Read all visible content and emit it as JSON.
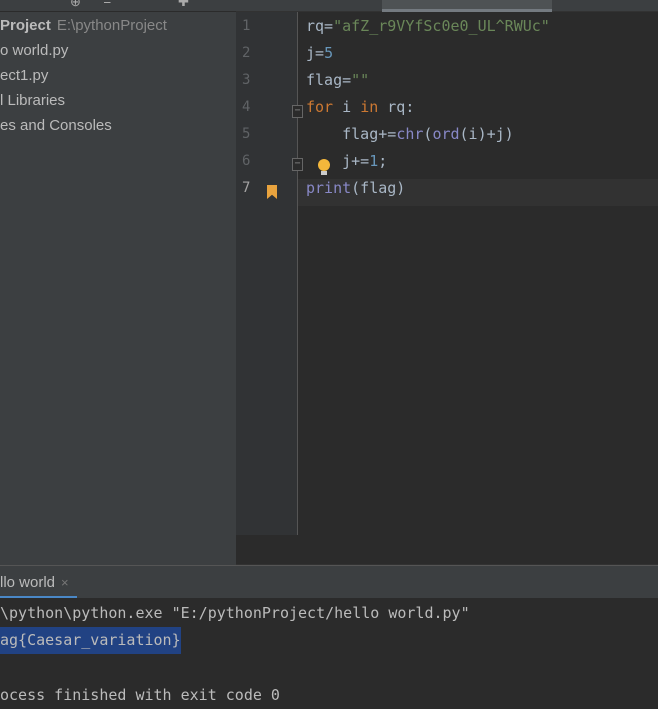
{
  "project_panel": {
    "title": "Project",
    "path": "E:\\pythonProject",
    "items": [
      "o world.py",
      "ect1.py",
      "l Libraries",
      "es and Consoles"
    ]
  },
  "editor": {
    "line_numbers": [
      "1",
      "2",
      "3",
      "4",
      "5",
      "6",
      "7"
    ],
    "lines": [
      {
        "parts": [
          [
            "",
            "rq="
          ],
          [
            "str",
            "\"afZ_r9VYfSc0e0_UL^RWUc\""
          ]
        ]
      },
      {
        "parts": [
          [
            "",
            "j="
          ],
          [
            "num",
            "5"
          ]
        ]
      },
      {
        "parts": [
          [
            "",
            "flag="
          ],
          [
            "str",
            "\"\""
          ]
        ]
      },
      {
        "parts": [
          [
            "kw",
            "for"
          ],
          [
            "",
            " i "
          ],
          [
            "kw",
            "in"
          ],
          [
            "",
            " rq:"
          ]
        ]
      },
      {
        "parts": [
          [
            "",
            "    flag+="
          ],
          [
            "fn",
            "chr"
          ],
          [
            "",
            "("
          ],
          [
            "fn",
            "ord"
          ],
          [
            "",
            "(i)+j)"
          ]
        ]
      },
      {
        "parts": [
          [
            "",
            "    j+="
          ],
          [
            "num",
            "1"
          ],
          [
            "",
            ";"
          ]
        ]
      },
      {
        "parts": [
          [
            "fn",
            "print"
          ],
          [
            "",
            "(flag)"
          ]
        ]
      }
    ],
    "current_line": "7",
    "bookmark_color": "#e8a33e"
  },
  "run_panel": {
    "tab_label": "llo world",
    "close_icon": "×",
    "console": [
      "\\python\\python.exe \"E:/pythonProject/hello world.py\"",
      "ag{Caesar_variation}",
      "",
      "ocess finished with exit code 0"
    ]
  }
}
